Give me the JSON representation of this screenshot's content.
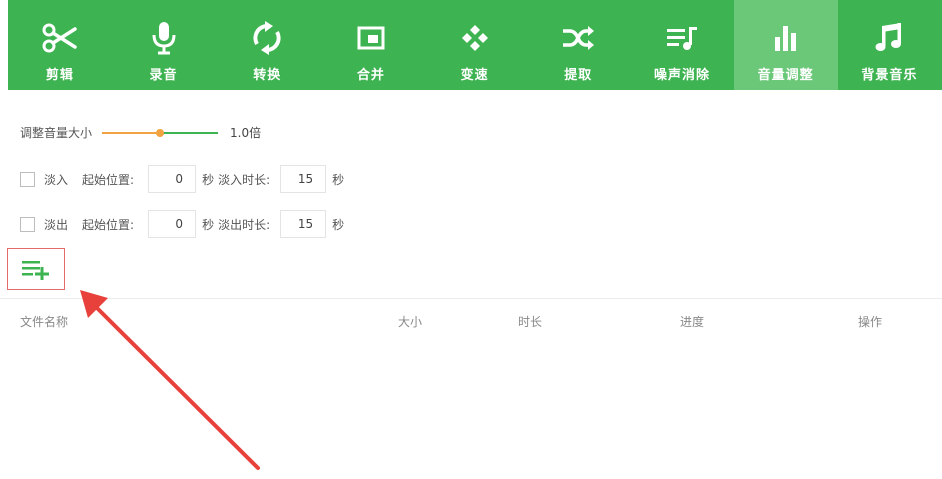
{
  "toolbar": {
    "items": [
      {
        "label": "剪辑",
        "icon": "scissors-icon"
      },
      {
        "label": "录音",
        "icon": "microphone-icon"
      },
      {
        "label": "转换",
        "icon": "sync-icon"
      },
      {
        "label": "合并",
        "icon": "merge-window-icon"
      },
      {
        "label": "变速",
        "icon": "gamepad-icon"
      },
      {
        "label": "提取",
        "icon": "shuffle-icon"
      },
      {
        "label": "噪声消除",
        "icon": "playlist-music-icon"
      },
      {
        "label": "音量调整",
        "icon": "bar-chart-icon"
      },
      {
        "label": "背景音乐",
        "icon": "music-note-icon"
      }
    ],
    "active_index": 7,
    "bg_color": "#3eb351",
    "active_color": "#6cc879"
  },
  "volume": {
    "label": "调整音量大小",
    "value_text": "1.0倍",
    "level": 0.5
  },
  "fade_in": {
    "label": "淡入",
    "checked": false,
    "start_label": "起始位置:",
    "start_value": "0",
    "start_unit": "秒",
    "duration_label": "淡入时长:",
    "duration_value": "15",
    "duration_unit": "秒"
  },
  "fade_out": {
    "label": "淡出",
    "checked": false,
    "start_label": "起始位置:",
    "start_value": "0",
    "start_unit": "秒",
    "duration_label": "淡出时长:",
    "duration_value": "15",
    "duration_unit": "秒"
  },
  "add_button": {
    "icon": "add-list-icon",
    "color": "#3eb351",
    "highlight_color": "#e56a6a"
  },
  "table": {
    "columns": [
      "文件名称",
      "大小",
      "时长",
      "进度",
      "操作"
    ]
  },
  "annotation": {
    "arrow_color": "#e8403a"
  }
}
